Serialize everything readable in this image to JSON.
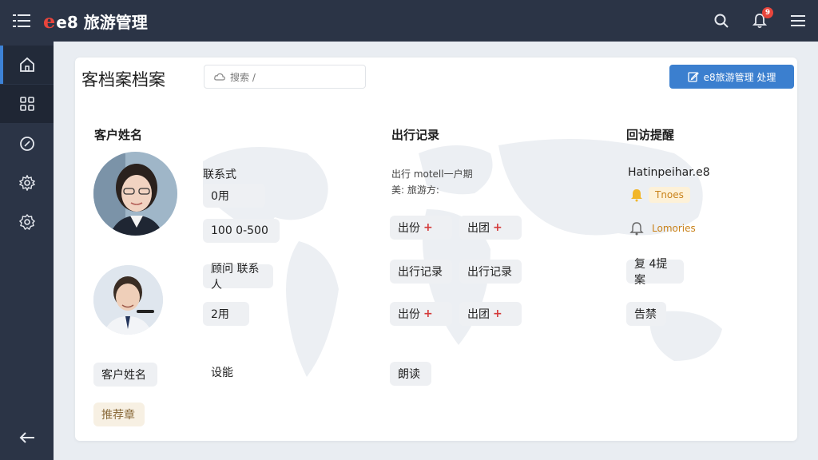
{
  "header": {
    "logo_mark": "e",
    "logo_text": "e8 旅游管理",
    "notification_count": "9"
  },
  "page": {
    "title": "客档案档案",
    "search_text": "搜索 /",
    "primary_button_label": "e8旅游管理 处理"
  },
  "columns": {
    "customer": {
      "heading": "客户姓名",
      "contact_label": "联系式",
      "pill_1": "0用",
      "pill_2": "100 0-500",
      "pill_3": "顾问 联系人",
      "pill_4": "2用",
      "pill_5": "设能",
      "bottom_pill": "客户姓名",
      "gold_pill": "推荐章"
    },
    "travel": {
      "heading": "出行记录",
      "line_1": "出行 motell一户期",
      "line_2": "美: 旅游方:",
      "pills": [
        {
          "label": "出份",
          "plus": "+"
        },
        {
          "label": "出团",
          "plus": "+"
        },
        {
          "label": "出行记录",
          "plus": ""
        },
        {
          "label": "出行记录",
          "plus": ""
        },
        {
          "label": "出份",
          "plus": "+"
        },
        {
          "label": "出团",
          "plus": "+"
        }
      ],
      "bottom_pill": "朗读"
    },
    "followup": {
      "heading": "回访提醒",
      "name": "Hatinpeihar.e8",
      "tag_1": "Tnoes",
      "tag_2": "Lomories",
      "pill_1": "复 4提案",
      "pill_2": "告禁"
    }
  },
  "colors": {
    "topbar": "#2b3446",
    "accent": "#3b7fcf",
    "logo_red": "#e8453c",
    "plus_red": "#d43a3a"
  },
  "icons": [
    "menu-icon",
    "search-icon",
    "bell-icon",
    "hamburger-icon",
    "home-icon",
    "grid-icon",
    "compass-icon",
    "settings-icon",
    "gear-icon",
    "back-arrow-icon",
    "cloud-icon",
    "edit-icon"
  ]
}
